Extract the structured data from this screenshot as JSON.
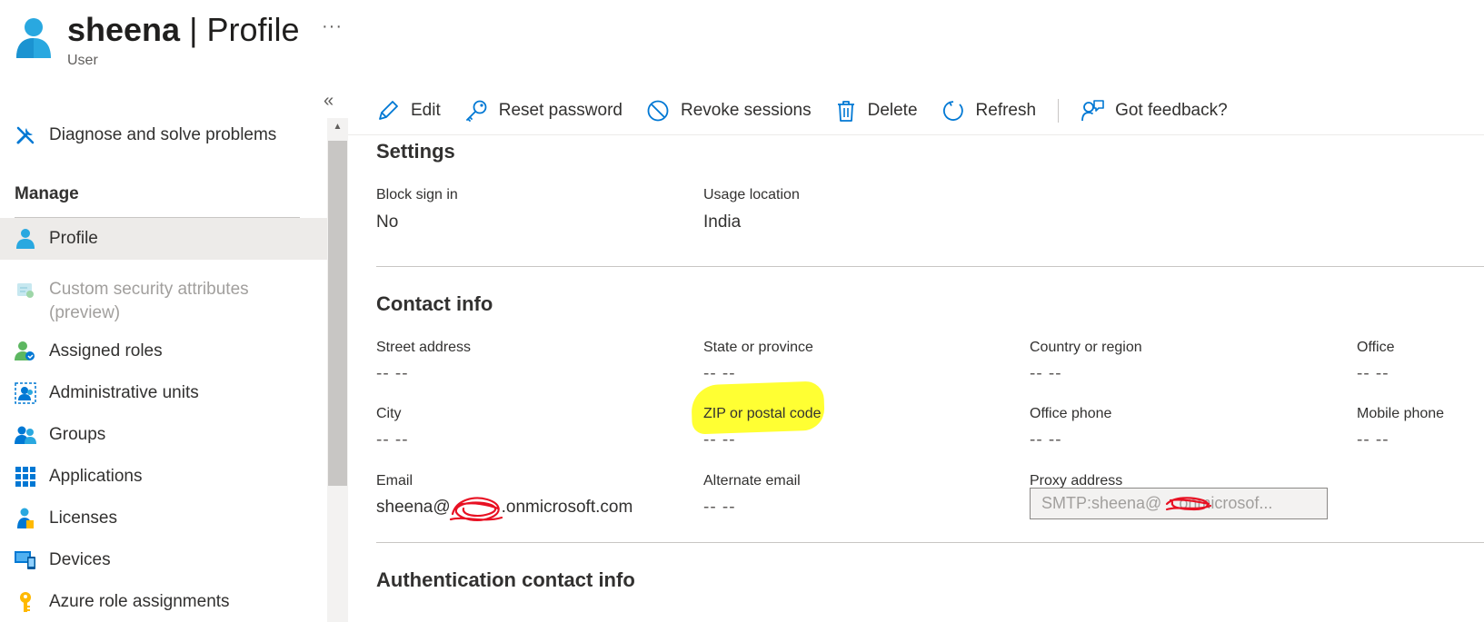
{
  "header": {
    "title_user": "sheena",
    "title_sep": "|",
    "title_page": "Profile",
    "subtitle": "User",
    "more_glyph": "···"
  },
  "sidebar": {
    "collapse_glyph": "«",
    "items": [
      {
        "label": "Diagnose and solve problems",
        "icon": "wrench-icon"
      },
      {
        "label": "Profile",
        "icon": "user-icon",
        "active": true
      },
      {
        "label": "Custom security attributes (preview)",
        "icon": "security-attributes-icon",
        "disabled": true
      },
      {
        "label": "Assigned roles",
        "icon": "assigned-roles-icon"
      },
      {
        "label": "Administrative units",
        "icon": "admin-units-icon"
      },
      {
        "label": "Groups",
        "icon": "groups-icon"
      },
      {
        "label": "Applications",
        "icon": "applications-icon"
      },
      {
        "label": "Licenses",
        "icon": "licenses-icon"
      },
      {
        "label": "Devices",
        "icon": "devices-icon"
      },
      {
        "label": "Azure role assignments",
        "icon": "key-icon"
      }
    ],
    "section_manage": "Manage"
  },
  "toolbar": {
    "edit": "Edit",
    "reset_password": "Reset password",
    "revoke_sessions": "Revoke sessions",
    "delete": "Delete",
    "refresh": "Refresh",
    "feedback": "Got feedback?"
  },
  "settings": {
    "title": "Settings",
    "block_sign_in_label": "Block sign in",
    "block_sign_in_value": "No",
    "usage_location_label": "Usage location",
    "usage_location_value": "India"
  },
  "contact": {
    "title": "Contact info",
    "street_label": "Street address",
    "street_value": "-- --",
    "state_label": "State or province",
    "state_value": "-- --",
    "country_label": "Country or region",
    "country_value": "-- --",
    "office_label": "Office",
    "office_value": "-- --",
    "city_label": "City",
    "city_value": "-- --",
    "zip_label": "ZIP or postal code",
    "zip_value": "-- --",
    "office_phone_label": "Office phone",
    "office_phone_value": "-- --",
    "mobile_label": "Mobile phone",
    "mobile_value": "-- --",
    "email_label": "Email",
    "email_value_start": "sheena@",
    "email_value_end": ".onmicrosoft.com",
    "alt_email_label": "Alternate email",
    "alt_email_value": "-- --",
    "proxy_label": "Proxy address",
    "proxy_value_start": "SMTP:sheena@",
    "proxy_value_end": ".onmicrosof..."
  },
  "auth": {
    "title": "Authentication contact info"
  },
  "colors": {
    "accent": "#0078d4",
    "highlight": "#ffff33",
    "redaction": "#e81123"
  }
}
